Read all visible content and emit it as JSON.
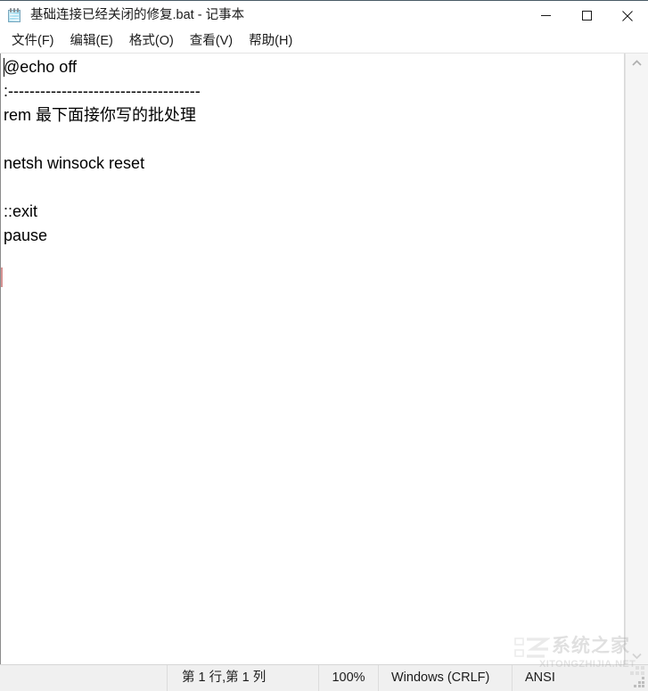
{
  "window": {
    "title": "基础连接已经关闭的修复.bat - 记事本",
    "app_icon": "notepad-icon",
    "controls": {
      "minimize": "minimize-icon",
      "maximize": "maximize-icon",
      "close": "close-icon"
    }
  },
  "menubar": {
    "items": [
      {
        "label": "文件(F)"
      },
      {
        "label": "编辑(E)"
      },
      {
        "label": "格式(O)"
      },
      {
        "label": "查看(V)"
      },
      {
        "label": "帮助(H)"
      }
    ]
  },
  "editor": {
    "content": "@echo off\n:------------------------------------\nrem 最下面接你写的批处理\n\nnetsh winsock reset\n\n::exit\npause",
    "lines": [
      "@echo off",
      ":------------------------------------",
      "rem 最下面接你写的批处理",
      "",
      "netsh winsock reset",
      "",
      "::exit",
      "pause"
    ]
  },
  "scrollbar": {
    "up_arrow": "chevron-up-icon",
    "down_arrow": "chevron-down-icon"
  },
  "statusbar": {
    "position": "第 1 行,第 1 列",
    "zoom": "100%",
    "line_ending": "Windows (CRLF)",
    "encoding": "ANSI"
  },
  "watermark": {
    "chinese": "系统之家",
    "english": "XITONGZHIJIA.NET"
  },
  "colors": {
    "window_bg": "#ffffff",
    "statusbar_bg": "#f0f0f0",
    "text": "#000000",
    "titlebar_border": "#4a5b66"
  }
}
